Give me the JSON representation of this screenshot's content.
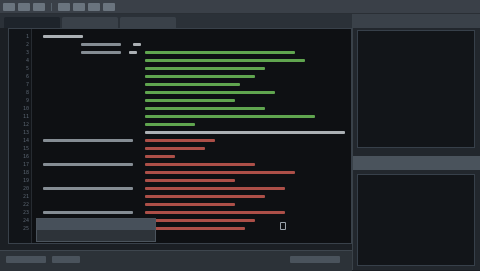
{
  "colors": {
    "comment": "#6fbf5a",
    "keyword": "#c7ccd1",
    "string": "#c85b52",
    "gray": "#9aa3ab"
  },
  "menubar_icons": [
    "menu-icon",
    "menu-icon",
    "menu-icon",
    "menu-icon",
    "menu-icon",
    "menu-icon",
    "menu-icon"
  ],
  "tabs": [
    {
      "label": "",
      "active": true
    },
    {
      "label": "",
      "active": false
    },
    {
      "label": "",
      "active": false
    }
  ],
  "editor": {
    "lines": [
      {
        "n": "1",
        "segs": [
          [
            10,
            40,
            "keyword"
          ]
        ]
      },
      {
        "n": "2",
        "segs": [
          [
            48,
            40,
            "gray"
          ],
          [
            100,
            8,
            "keyword"
          ]
        ]
      },
      {
        "n": "3",
        "segs": [
          [
            48,
            40,
            "gray"
          ],
          [
            96,
            8,
            "keyword"
          ],
          [
            112,
            150,
            "comment"
          ]
        ]
      },
      {
        "n": "4",
        "segs": [
          [
            112,
            160,
            "comment"
          ]
        ]
      },
      {
        "n": "5",
        "segs": [
          [
            112,
            120,
            "comment"
          ]
        ]
      },
      {
        "n": "6",
        "segs": [
          [
            112,
            110,
            "comment"
          ]
        ]
      },
      {
        "n": "7",
        "segs": [
          [
            112,
            95,
            "comment"
          ]
        ]
      },
      {
        "n": "8",
        "segs": [
          [
            112,
            130,
            "comment"
          ]
        ]
      },
      {
        "n": "9",
        "segs": [
          [
            112,
            90,
            "comment"
          ]
        ]
      },
      {
        "n": "10",
        "segs": [
          [
            112,
            120,
            "comment"
          ]
        ]
      },
      {
        "n": "11",
        "segs": [
          [
            112,
            170,
            "comment"
          ]
        ]
      },
      {
        "n": "12",
        "segs": [
          [
            112,
            50,
            "comment"
          ]
        ]
      },
      {
        "n": "13",
        "segs": [
          [
            112,
            200,
            "keyword"
          ]
        ]
      },
      {
        "n": "14",
        "segs": [
          [
            10,
            90,
            "gray"
          ],
          [
            112,
            70,
            "string"
          ]
        ]
      },
      {
        "n": "15",
        "segs": [
          [
            112,
            60,
            "string"
          ]
        ]
      },
      {
        "n": "16",
        "segs": [
          [
            112,
            30,
            "string"
          ]
        ]
      },
      {
        "n": "17",
        "segs": [
          [
            10,
            90,
            "gray"
          ],
          [
            112,
            110,
            "string"
          ]
        ]
      },
      {
        "n": "18",
        "segs": [
          [
            112,
            150,
            "string"
          ]
        ]
      },
      {
        "n": "19",
        "segs": [
          [
            112,
            90,
            "string"
          ]
        ]
      },
      {
        "n": "20",
        "segs": [
          [
            10,
            90,
            "gray"
          ],
          [
            112,
            140,
            "string"
          ]
        ]
      },
      {
        "n": "21",
        "segs": [
          [
            112,
            120,
            "string"
          ]
        ]
      },
      {
        "n": "22",
        "segs": [
          [
            112,
            90,
            "string"
          ]
        ]
      },
      {
        "n": "23",
        "segs": [
          [
            10,
            90,
            "gray"
          ],
          [
            112,
            140,
            "string"
          ]
        ]
      },
      {
        "n": "24",
        "segs": [
          [
            112,
            110,
            "string"
          ]
        ]
      },
      {
        "n": "25",
        "segs": [
          [
            112,
            100,
            "string"
          ]
        ]
      }
    ]
  },
  "dropdown": {
    "items": [
      "",
      ""
    ]
  },
  "rightpanel": {
    "title": "",
    "label": "",
    "divider_title": ""
  }
}
